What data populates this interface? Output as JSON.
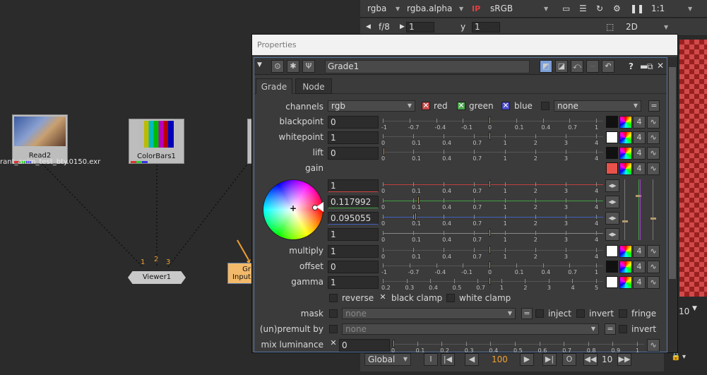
{
  "graph": {
    "read2": {
      "label": "Read2",
      "file": "rant_anim_test_bty.0150.exr"
    },
    "colorbars": {
      "label": "ColorBars1"
    },
    "viewer": {
      "label": "Viewer1",
      "inputs": [
        "1",
        "2",
        "3"
      ]
    },
    "grade_node": {
      "line1": "Gr",
      "line2": "Input"
    }
  },
  "viewer": {
    "channels": "rgba",
    "alpha": "rgba.alpha",
    "ip": "IP",
    "colorspace": "sRGB",
    "zoom": "1:1",
    "fstop": "f/8",
    "gain": "1",
    "y_label": "y",
    "gamma": "1",
    "mode": "2D",
    "frame_end": "10"
  },
  "properties": {
    "title": "Properties",
    "node_name": "Grade1",
    "tabs": [
      "Grade",
      "Node"
    ],
    "channels_label": "channels",
    "channels_value": "rgb",
    "ch_red": "red",
    "ch_green": "green",
    "ch_blue": "blue",
    "ch_extra": "none",
    "rows": {
      "blackpoint": {
        "label": "blackpoint",
        "value": "0"
      },
      "whitepoint": {
        "label": "whitepoint",
        "value": "1"
      },
      "lift": {
        "label": "lift",
        "value": "0"
      },
      "gain": {
        "label": "gain"
      },
      "gain_r": "1",
      "gain_g": "0.117992",
      "gain_b": "0.095055",
      "gain_a": "1",
      "multiply": {
        "label": "multiply",
        "value": "1"
      },
      "offset": {
        "label": "offset",
        "value": "0"
      },
      "gamma": {
        "label": "gamma",
        "value": "1"
      }
    },
    "ticks_a": [
      "-1",
      "-0.7",
      "-0.4",
      "-0.1",
      "0",
      "0.1",
      "0.4",
      "0.7",
      "1"
    ],
    "ticks_b": [
      "0",
      "0.1",
      "0.4",
      "0.7",
      "1",
      "2",
      "3",
      "4"
    ],
    "ticks_gamma": [
      "0.2",
      "0.3",
      "0.4",
      "0.5",
      "0.7",
      "1",
      "2",
      "3",
      "4",
      "5"
    ],
    "ticks_mix": [
      "0",
      "0.1",
      "0.2",
      "0.3",
      "0.4",
      "0.5",
      "0.6",
      "0.7",
      "0.8",
      "0.9",
      "1"
    ],
    "swatch_count": "4",
    "reverse": "reverse",
    "black_clamp": "black clamp",
    "white_clamp": "white clamp",
    "mask_label": "mask",
    "mask_value": "none",
    "inject": "inject",
    "invert": "invert",
    "fringe": "fringe",
    "premult_label": "(un)premult by",
    "premult_value": "none",
    "invert2": "invert",
    "mix_label": "mix luminance",
    "mix_value": "0"
  },
  "playback": {
    "scope": "Global",
    "frame": "100",
    "step": "10"
  },
  "colors": {
    "gain_swatch": "#e8524a",
    "accent": "#f0a030"
  }
}
